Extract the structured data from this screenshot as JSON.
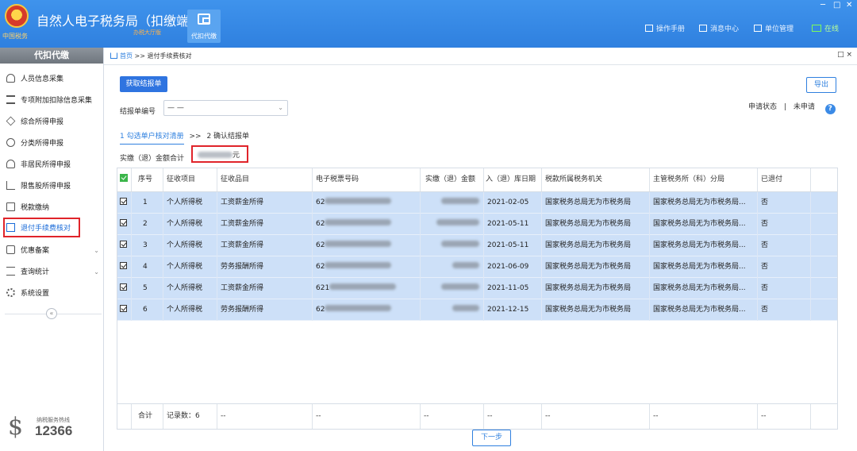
{
  "app": {
    "title": "自然人电子税务局（扣缴端）",
    "subtitle": "办税大厅版",
    "emblem_text": "中国税务",
    "module_label": "代扣代缴",
    "top_links": [
      "操作手册",
      "消息中心",
      "单位管理",
      "在线"
    ],
    "window_controls": [
      "─",
      "□",
      "✕"
    ]
  },
  "sidebar": {
    "header": "代扣代缴",
    "items": [
      {
        "label": "人员信息采集",
        "icon": "person-icon"
      },
      {
        "label": "专项附加扣除信息采集",
        "icon": "list-icon"
      },
      {
        "label": "综合所得申报",
        "icon": "layers-icon"
      },
      {
        "label": "分类所得申报",
        "icon": "pie-icon"
      },
      {
        "label": "非居民所得申报",
        "icon": "person-icon"
      },
      {
        "label": "限售股所得申报",
        "icon": "bar-chart-icon"
      },
      {
        "label": "税款缴纳",
        "icon": "folder-icon"
      },
      {
        "label": "退付手续费核对",
        "icon": "document-icon"
      },
      {
        "label": "优惠备案",
        "icon": "document-icon"
      },
      {
        "label": "查询统计",
        "icon": "search-list-icon"
      },
      {
        "label": "系统设置",
        "icon": "gear-icon"
      }
    ],
    "collapse": "«",
    "hotline_label": "纳税服务热线",
    "hotline_number": "12366"
  },
  "breadcrumb": {
    "home": "首页",
    "sep": ">>",
    "current": "退付手续费核对",
    "controls": "□ ×"
  },
  "toolbar": {
    "fetch": "获取结报单",
    "export": "导出"
  },
  "filter": {
    "bill_label": "结报单编号",
    "bill_value": "— —",
    "status_label": "申请状态",
    "status_sep": "|",
    "status_value": "未申请",
    "help": "?"
  },
  "steps": {
    "step1": "1 勾选单户核对清册",
    "sep": ">>",
    "step2": "2 确认结报单"
  },
  "amount": {
    "label": "实缴（退）金额合计",
    "unit": "元"
  },
  "table": {
    "headers": [
      "",
      "序号",
      "征收项目",
      "征收品目",
      "电子税票号码",
      "实缴（退）金额",
      "入（退）库日期",
      "税款所属税务机关",
      "主管税务所（科）分局",
      "已退付",
      ""
    ],
    "rows": [
      {
        "no": "1",
        "item": "个人所得税",
        "subitem": "工资薪金所得",
        "ticket": "62",
        "date": "2021-02-05",
        "office": "国家税务总局无为市税务局",
        "branch": "国家税务总局无为市税务局...",
        "refunded": "否"
      },
      {
        "no": "2",
        "item": "个人所得税",
        "subitem": "工资薪金所得",
        "ticket": "62",
        "date": "2021-05-11",
        "office": "国家税务总局无为市税务局",
        "branch": "国家税务总局无为市税务局...",
        "refunded": "否"
      },
      {
        "no": "3",
        "item": "个人所得税",
        "subitem": "工资薪金所得",
        "ticket": "62",
        "date": "2021-05-11",
        "office": "国家税务总局无为市税务局",
        "branch": "国家税务总局无为市税务局...",
        "refunded": "否"
      },
      {
        "no": "4",
        "item": "个人所得税",
        "subitem": "劳务报酬所得",
        "ticket": "62",
        "date": "2021-06-09",
        "office": "国家税务总局无为市税务局",
        "branch": "国家税务总局无为市税务局...",
        "refunded": "否"
      },
      {
        "no": "5",
        "item": "个人所得税",
        "subitem": "工资薪金所得",
        "ticket": "621",
        "date": "2021-11-05",
        "office": "国家税务总局无为市税务局",
        "branch": "国家税务总局无为市税务局...",
        "refunded": "否"
      },
      {
        "no": "6",
        "item": "个人所得税",
        "subitem": "劳务报酬所得",
        "ticket": "62",
        "date": "2021-12-15",
        "office": "国家税务总局无为市税务局",
        "branch": "国家税务总局无为市税务局...",
        "refunded": "否"
      }
    ],
    "footer": {
      "total_label": "合计",
      "count_label": "记录数：6",
      "dash": "--"
    }
  },
  "next": "下一步"
}
